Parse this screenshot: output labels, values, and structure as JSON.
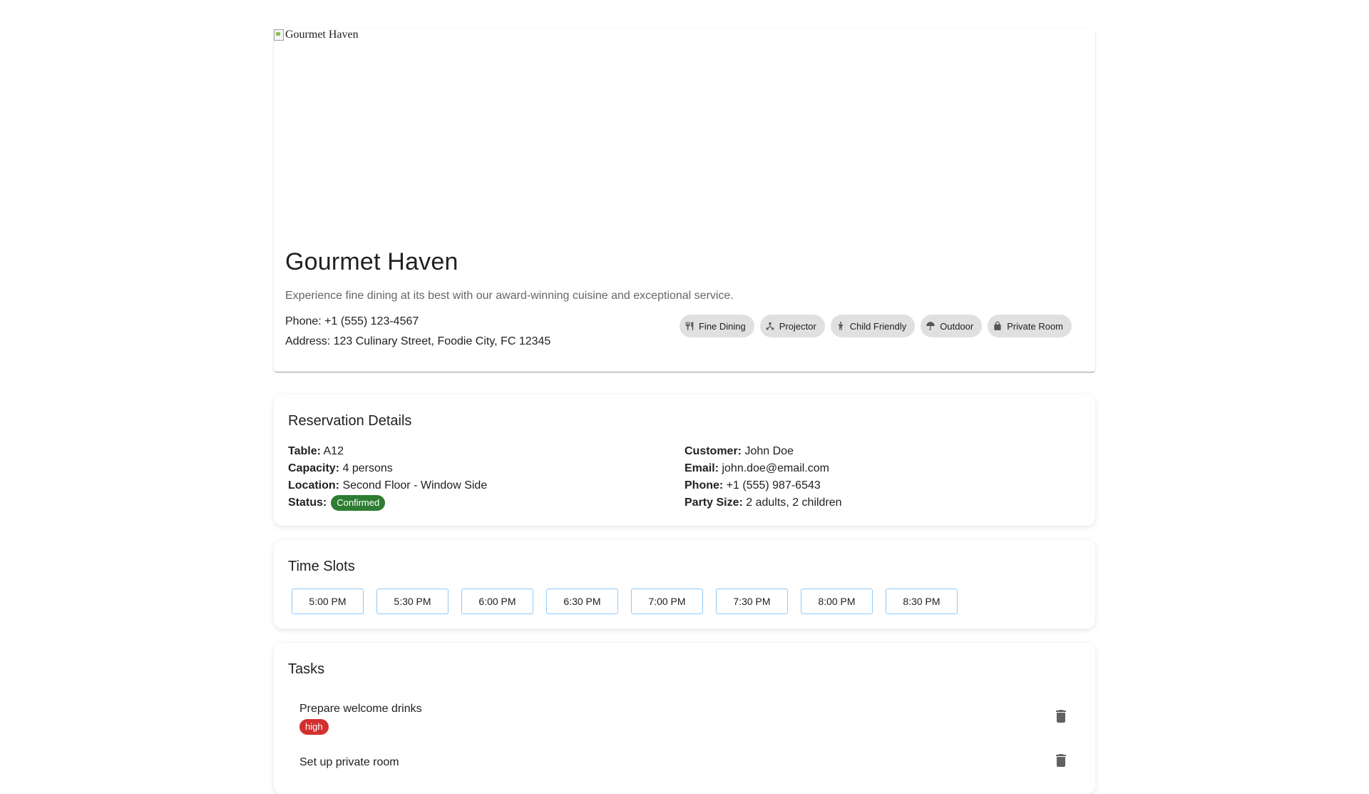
{
  "restaurant": {
    "image_alt": "Gourmet Haven",
    "name": "Gourmet Haven",
    "description": "Experience fine dining at its best with our award-winning cuisine and exceptional service.",
    "phone_line": "Phone: +1 (555) 123-4567",
    "address_line": "Address: 123 Culinary Street, Foodie City, FC 12345",
    "amenities": [
      {
        "label": "Fine Dining",
        "icon": "utensils-icon"
      },
      {
        "label": "Projector",
        "icon": "projector-icon"
      },
      {
        "label": "Child Friendly",
        "icon": "child-icon"
      },
      {
        "label": "Outdoor",
        "icon": "umbrella-icon"
      },
      {
        "label": "Private Room",
        "icon": "lock-icon"
      }
    ]
  },
  "reservation": {
    "title": "Reservation Details",
    "left": [
      {
        "label": "Table:",
        "value": "A12"
      },
      {
        "label": "Capacity:",
        "value": "4 persons"
      },
      {
        "label": "Location:",
        "value": "Second Floor - Window Side"
      }
    ],
    "status_label": "Status:",
    "status_value": "Confirmed",
    "status_color": "#2e7d32",
    "right": [
      {
        "label": "Customer:",
        "value": "John Doe"
      },
      {
        "label": "Email:",
        "value": "john.doe@email.com"
      },
      {
        "label": "Phone:",
        "value": "+1 (555) 987-6543"
      },
      {
        "label": "Party Size:",
        "value": "2 adults, 2 children"
      }
    ]
  },
  "time_slots": {
    "title": "Time Slots",
    "slots": [
      "5:00 PM",
      "5:30 PM",
      "6:00 PM",
      "6:30 PM",
      "7:00 PM",
      "7:30 PM",
      "8:00 PM",
      "8:30 PM"
    ]
  },
  "tasks": {
    "title": "Tasks",
    "items": [
      {
        "text": "Prepare welcome drinks",
        "priority": "high",
        "priority_color": "#d32f2f"
      },
      {
        "text": "Set up private room",
        "priority": "",
        "priority_color": ""
      }
    ]
  }
}
